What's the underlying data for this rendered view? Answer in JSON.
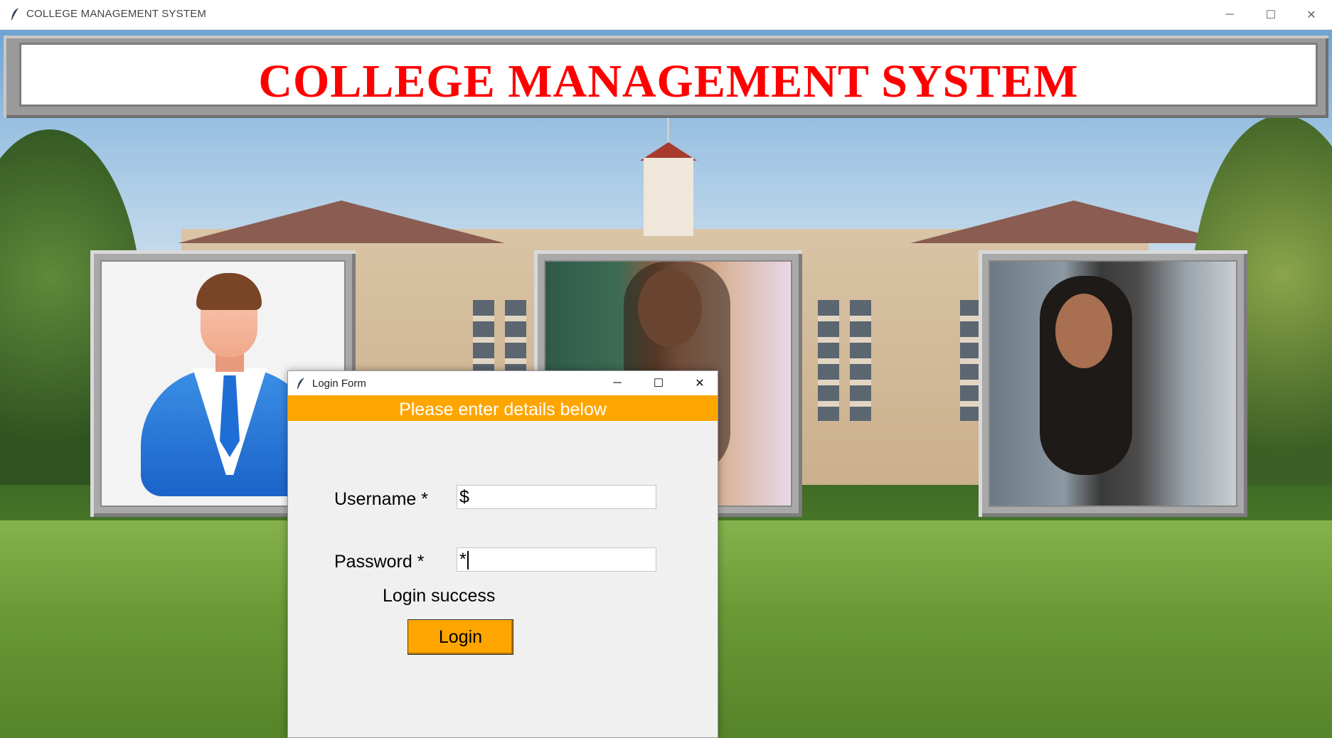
{
  "window": {
    "title": "COLLEGE MANAGEMENT SYSTEM",
    "app_icon": "feather-icon",
    "controls": {
      "minimize": "─",
      "maximize": "☐",
      "close": "✕"
    }
  },
  "banner": {
    "title": "COLLEGE MANAGEMENT SYSTEM",
    "title_color": "#ff0000"
  },
  "images": [
    {
      "name": "admin-avatar",
      "icon": "user-avatar-icon"
    },
    {
      "name": "student-photo-1",
      "icon": "photo-icon"
    },
    {
      "name": "student-photo-2",
      "icon": "photo-icon"
    }
  ],
  "login_dialog": {
    "title": "Login Form",
    "app_icon": "feather-icon",
    "controls": {
      "minimize": "─",
      "maximize": "☐",
      "close": "✕"
    },
    "header_text": "Please enter details below",
    "header_color": "#ffa500",
    "username_label": "Username *",
    "username_value": "$",
    "password_label": "Password *",
    "password_value": "*",
    "status_text": "Login success",
    "login_button": "Login",
    "button_color": "#ffa500"
  }
}
